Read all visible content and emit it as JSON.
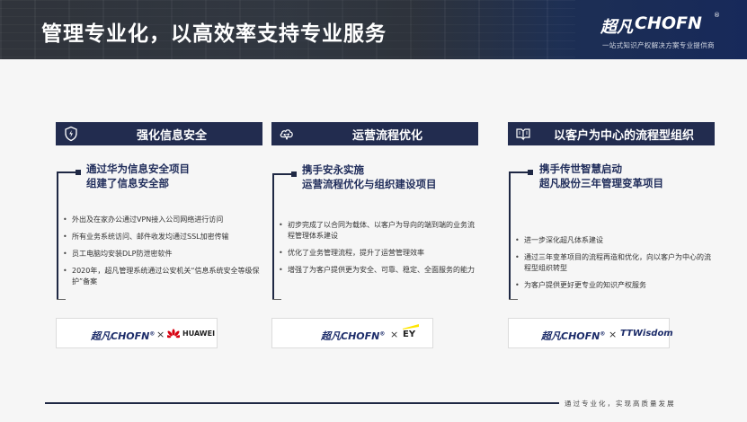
{
  "banner": {
    "title": "管理专业化，以高效率支持专业服务",
    "brand_cn": "超凡",
    "brand_en": "CHOFN",
    "brand_reg": "®",
    "brand_tagline": "一站式知识产权解决方案专业提供商"
  },
  "columns": [
    {
      "header": "强化信息安全",
      "icon": "shield-icon",
      "headline": [
        "通过华为信息安全项目",
        "组建了信息安全部"
      ],
      "bullets": [
        "外出及在家办公通过VPN接入公司网络进行访问",
        "所有业务系统访问、邮件收发均通过SSL加密传输",
        "员工电脑均安装DLP防泄密软件",
        "2020年，超凡管理系统通过公安机关“信息系统安全等级保护”备案"
      ],
      "logo": {
        "chofn": "超凡CHOFN",
        "reg": "®",
        "x": "×",
        "partner": "HUAWEI",
        "partner_icon": "huawei-flower-icon"
      }
    },
    {
      "header": "运营流程优化",
      "icon": "cloud-network-icon",
      "headline": [
        "携手安永实施",
        "运营流程优化与组织建设项目"
      ],
      "bullets": [
        "初步完成了以合同为载体、以客户为导向的端到端的业务流程管理体系建设",
        "优化了业务管理流程，提升了运营管理效率",
        "增强了为客户提供更为安全、可靠、稳定、全面服务的能力"
      ],
      "logo": {
        "chofn": "超凡CHOFN",
        "reg": "®",
        "x": "×",
        "partner": "EY",
        "partner_icon": "ey-logo-icon"
      }
    },
    {
      "header": "以客户为中心的流程型组织",
      "icon": "book-icon",
      "headline": [
        "携手传世智慧启动",
        "超凡股份三年管理变革项目"
      ],
      "bullets": [
        "进一步深化超凡体系建设",
        "通过三年变革项目的流程再造和优化，向以客户为中心的流程型组织转型",
        "为客户提供更好更专业的知识产权服务"
      ],
      "logo": {
        "chofn": "超凡CHOFN",
        "reg": "®",
        "x": "×",
        "partner": "TTWisdom",
        "partner_icon": ""
      }
    }
  ],
  "footer": {
    "text": "通过专业化，实现高质量发展"
  }
}
